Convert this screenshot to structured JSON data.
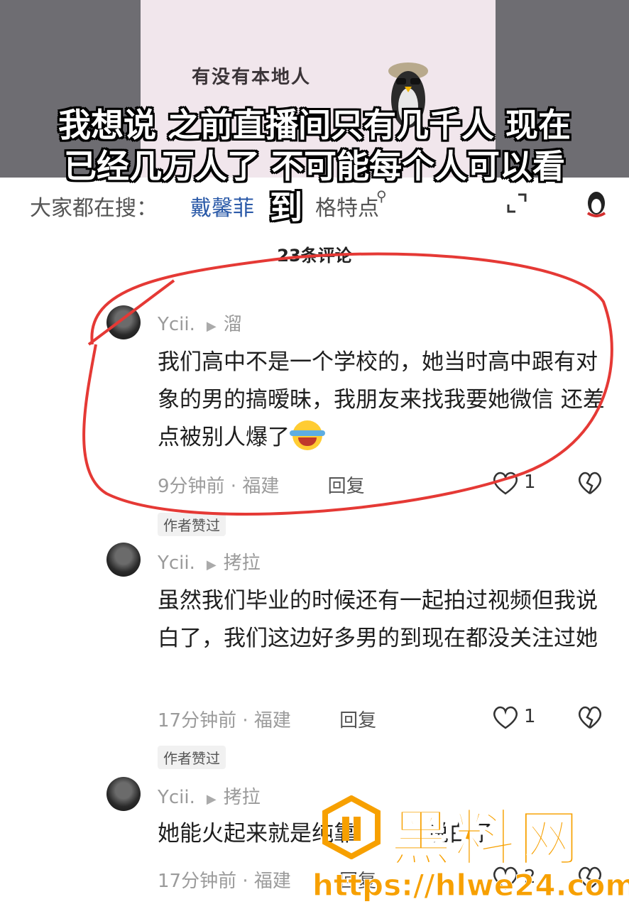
{
  "video": {
    "sign_text": "有没有本地人",
    "caption_line1": "我想说 之前直播间只有几千人 现在",
    "caption_line2": "已经几万人了 不可能每个人可以看",
    "caption_line3": "到"
  },
  "search": {
    "label": "大家都在搜：",
    "term": "戴馨菲",
    "term_suffix": "格特点"
  },
  "comments_count": "23条评论",
  "comments": [
    {
      "username": "Ycii.",
      "source": "溜",
      "text": "我们高中不是一个学校的，她当时高中跟有对象的男的搞暧昧，我朋友来找我要她微信 还差点被别人爆了",
      "time": "9分钟前",
      "location": "福建",
      "reply": "回复",
      "likes": "1",
      "tag": "作者赞过"
    },
    {
      "username": "Ycii.",
      "source": "拷拉",
      "text": "虽然我们毕业的时候还有一起拍过视频但我说白了，我们这边好多男的到现在都没关注过她",
      "time": "17分钟前",
      "location": "福建",
      "reply": "回复",
      "likes": "1",
      "tag": "作者赞过"
    },
    {
      "username": "Ycii.",
      "source": "拷拉",
      "text": "她能火起来就是纯靠",
      "text_tail": "说白了",
      "time": "17分钟前",
      "location": "福建",
      "reply": "回复",
      "likes": "2"
    }
  ],
  "watermark": {
    "title": "黑料网",
    "url": "https://hlwe24.com"
  },
  "colors": {
    "highlight_ellipse": "#e53935",
    "watermark": "#f7a000",
    "search_term": "#2b5aa8"
  }
}
